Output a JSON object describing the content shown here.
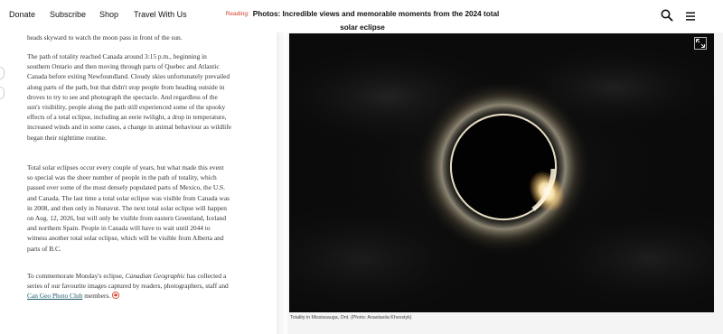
{
  "nav": {
    "links": [
      "Donate",
      "Subscribe",
      "Shop",
      "Travel With Us"
    ],
    "reading_label": "Reading:",
    "reading_title": "Photos: Incredible views and memorable moments from the 2024 total solar eclipse"
  },
  "icons": {
    "search": "search-icon",
    "menu": "hamburger-menu-icon",
    "expand": "expand-icon",
    "maple": "maple-leaf-icon"
  },
  "article": {
    "fragment": "heads skyward to watch the moon pass in front of the sun.",
    "p1": "The path of totality reached Canada around 3:15 p.m., beginning in southern Ontario and then moving through parts of Quebec and Atlantic Canada before exiting Newfoundland. Cloudy skies unfortunately prevailed along parts of the path, but that didn't stop people from heading outside in droves to try to see and photograph the spectacle. And regardless of the sun's visibility, people along the path still experienced some of the spooky effects of a total eclipse, including an eerie twilight, a drop in temperature, increased winds and in some cases, a change in animal behaviour as wildlife began their nighttime routine.",
    "p2": "Total solar eclipses occur every couple of years, but what made this event so special was the sheer number of people in the path of totality, which passed over some of the most densely populated parts of Mexico, the U.S. and Canada. The last time a total solar eclipse was visible from Canada was in 2008, and then only in Nunavut. The next total solar eclipse will happen on Aug. 12, 2026, but will only be visible from eastern Greenland, Iceland and northern Spain. People in Canada will have to wait until 2044 to witness another total solar eclipse, which will be visible from Alberta and parts of B.C.",
    "p3_before": "To commemorate Monday's eclipse,",
    "p3_mag": "Canadian Geographic",
    "p3_mid": "has collected a series of our favourite images captured by readers, photographers, staff and",
    "p3_link": "Can Geo Photo Club",
    "p3_after": "members."
  },
  "photo": {
    "caption": "Totality in Mississauga, Ont. (Photo: Anastasiia Khvostyk)"
  },
  "colors": {
    "accent_red": "#d23c2a",
    "link_teal": "#1a5a6b"
  }
}
